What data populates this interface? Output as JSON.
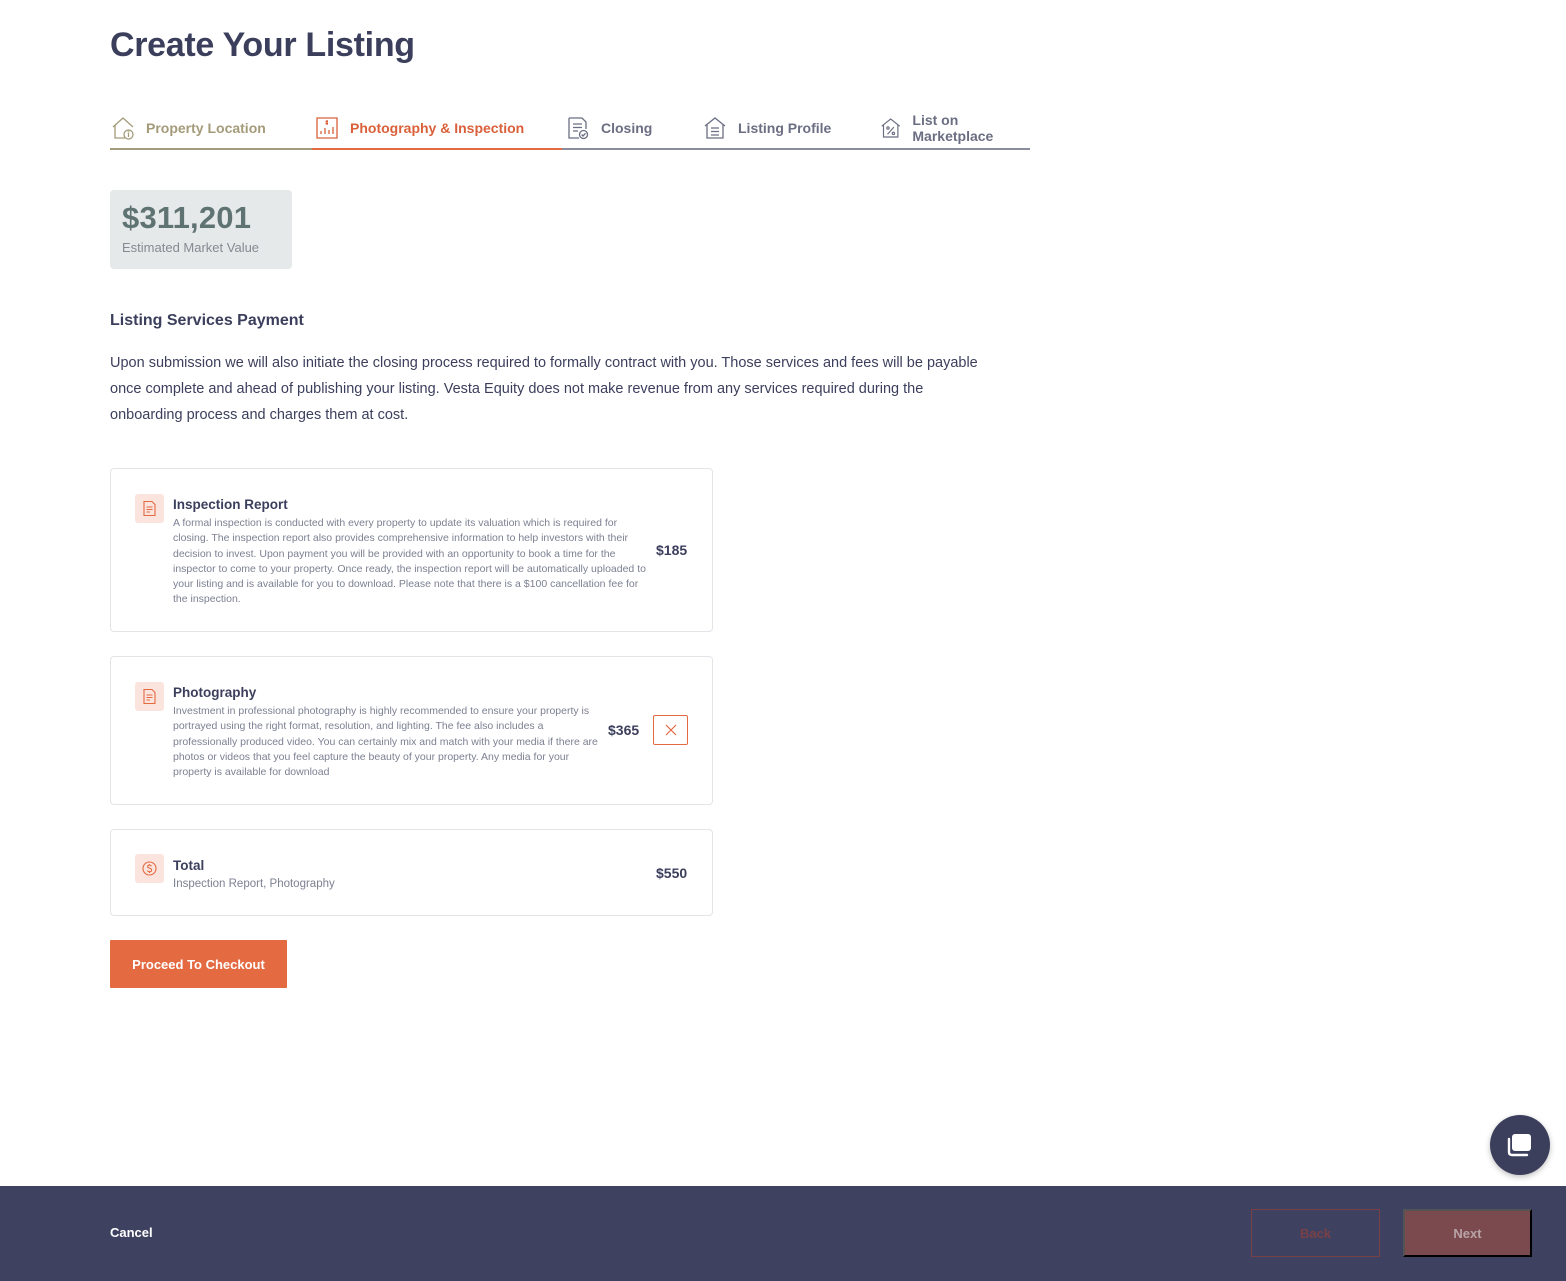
{
  "page": {
    "title": "Create Your Listing"
  },
  "steps": [
    {
      "label": "Property Location",
      "icon": "house-info-icon",
      "state": "done"
    },
    {
      "label": "Photography & Inspection",
      "icon": "document-chart-icon",
      "state": "active"
    },
    {
      "label": "Closing",
      "icon": "document-check-icon",
      "state": "pending"
    },
    {
      "label": "Listing Profile",
      "icon": "house-list-icon",
      "state": "pending"
    },
    {
      "label": "List on Marketplace",
      "icon": "house-percent-icon",
      "state": "pending"
    }
  ],
  "valuation": {
    "amount": "$311,201",
    "label": "Estimated Market Value"
  },
  "section": {
    "title": "Listing Services Payment",
    "description": "Upon submission we will also initiate the closing process required to formally contract with you. Those services and fees will be payable once complete and ahead of publishing your listing. Vesta Equity does not make revenue from any services required during the onboarding process and charges them at cost."
  },
  "services": [
    {
      "name": "Inspection Report",
      "icon": "document-icon",
      "description": "A formal inspection is conducted with every property to update its valuation which is required for closing. The inspection report also provides comprehensive information to help investors with their decision to invest. Upon payment you will be provided with an opportunity to book a time for the inspector to come to your property. Once ready, the inspection report will be automatically uploaded to your listing and is available for you to download. Please note that there is a $100 cancellation fee for the inspection.",
      "price": "$185",
      "removable": false
    },
    {
      "name": "Photography",
      "icon": "document-icon",
      "description": "Investment in professional photography is highly recommended to ensure your property is portrayed using the right format, resolution, and lighting. The fee also includes a professionally produced video. You can certainly mix and match with your media if there are photos or videos that you feel capture the beauty of your property. Any media for your property is available for download",
      "price": "$365",
      "removable": true
    }
  ],
  "total": {
    "name": "Total",
    "icon": "dollar-circle-icon",
    "items": "Inspection Report, Photography",
    "price": "$550"
  },
  "buttons": {
    "checkout": "Proceed To Checkout",
    "cancel": "Cancel",
    "back": "Back",
    "next": "Next"
  },
  "colors": {
    "accent": "#e46a42",
    "navy": "#3e4160",
    "done": "#a49b7a",
    "valueText": "#5f7373"
  },
  "chat": {
    "icon": "chat-icon"
  }
}
